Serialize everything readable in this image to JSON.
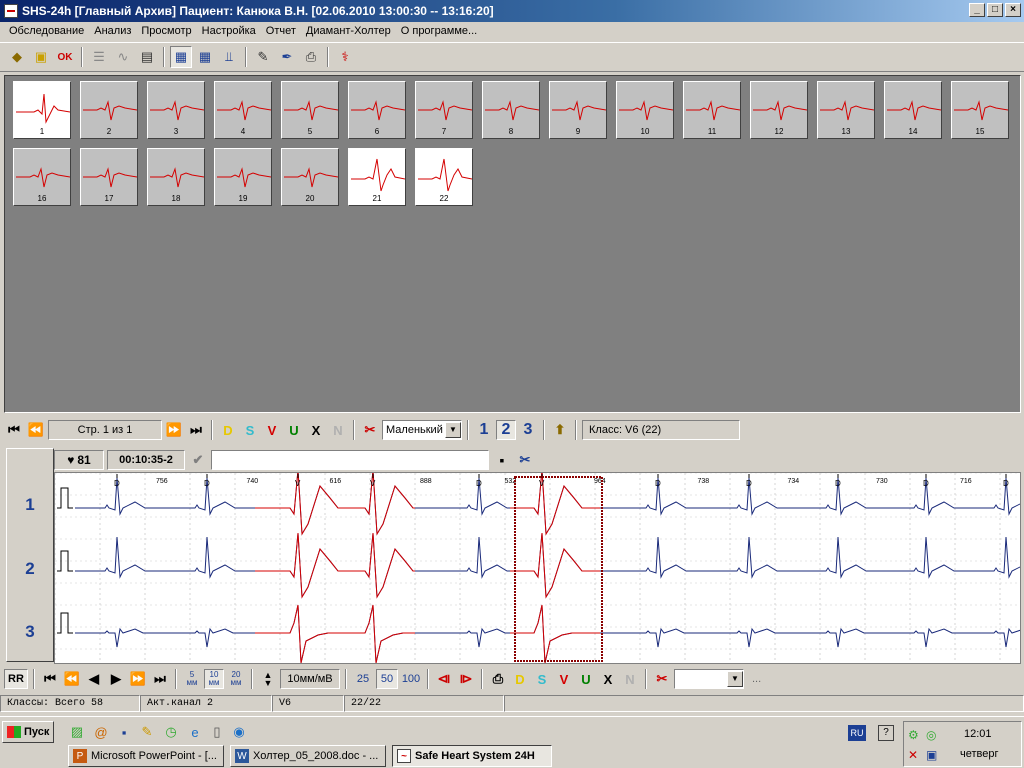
{
  "window": {
    "title": "SHS-24h [Главный Архив] Пациент: Канюка В.Н. [02.06.2010 13:00:30 -- 13:16:20]",
    "caption_buttons": [
      "_",
      "□",
      "×"
    ]
  },
  "menu": [
    "Обследование",
    "Анализ",
    "Просмотр",
    "Настройка",
    "Отчет",
    "Диамант-Холтер",
    "О программе..."
  ],
  "toolbar": {
    "icons": [
      "open-exam-icon",
      "folder-icon",
      "check-ok-icon",
      "list-icon",
      "ecg-icon",
      "table-icon",
      "classes-icon",
      "grid-icon",
      "chart-icon",
      "edit-icon",
      "pen-icon",
      "print-icon",
      "ecg-record-icon"
    ]
  },
  "classes": {
    "thumbnails": [
      {
        "n": "1",
        "selected": true
      },
      {
        "n": "2"
      },
      {
        "n": "3"
      },
      {
        "n": "4"
      },
      {
        "n": "5"
      },
      {
        "n": "6"
      },
      {
        "n": "7"
      },
      {
        "n": "8"
      },
      {
        "n": "9"
      },
      {
        "n": "10"
      },
      {
        "n": "11"
      },
      {
        "n": "12"
      },
      {
        "n": "13"
      },
      {
        "n": "14"
      },
      {
        "n": "15"
      },
      {
        "n": "16"
      },
      {
        "n": "17"
      },
      {
        "n": "18"
      },
      {
        "n": "19"
      },
      {
        "n": "20"
      },
      {
        "n": "21",
        "selected": true
      },
      {
        "n": "22",
        "selected": true
      }
    ]
  },
  "nav1": {
    "page": "Стр. 1 из 1",
    "type_letters": [
      "D",
      "S",
      "V",
      "U",
      "X",
      "N"
    ],
    "type_colors": [
      "#e6c800",
      "#33bbcc",
      "#d40000",
      "#008000",
      "#000000",
      "#b0b0b0"
    ],
    "size_value": "Маленький",
    "channels": [
      "1",
      "2",
      "3"
    ],
    "class_label": "Класс: V6 (22)"
  },
  "ecg": {
    "heart_rate": "81",
    "time": "00:10:35-2",
    "channel_labels": [
      "1",
      "2",
      "3"
    ],
    "beat_labels": [
      "D",
      "D",
      "V",
      "V",
      "D",
      "V",
      "D",
      "D",
      "D",
      "D",
      "D"
    ],
    "rr_values": [
      "756",
      "740",
      "616",
      "888",
      "532",
      "964",
      "738",
      "734",
      "730",
      "716"
    ],
    "colors": {
      "normal": "#1a2a7a",
      "ventricular": "#d40000",
      "selection": "#8a0000"
    }
  },
  "nav2": {
    "rr_label": "RR",
    "scale_buttons": [
      {
        "v": "5",
        "u": "мм"
      },
      {
        "v": "10",
        "u": "мм"
      },
      {
        "v": "20",
        "u": "мм"
      }
    ],
    "speed": "10мм/мВ",
    "gain_buttons": [
      "25",
      "50",
      "100"
    ],
    "more": "..."
  },
  "status": {
    "classes_total": "Классы: Всего 58",
    "active_channel": "Акт.канал 2",
    "class_name": "V6",
    "class_count": "22/22"
  },
  "taskbar": {
    "start": "Пуск",
    "tasks": [
      "Microsoft PowerPoint - [...",
      "Холтер_05_2008.doc - ...",
      "Safe Heart System 24H"
    ],
    "lang": "RU",
    "time": "12:01",
    "day": "четверг"
  }
}
